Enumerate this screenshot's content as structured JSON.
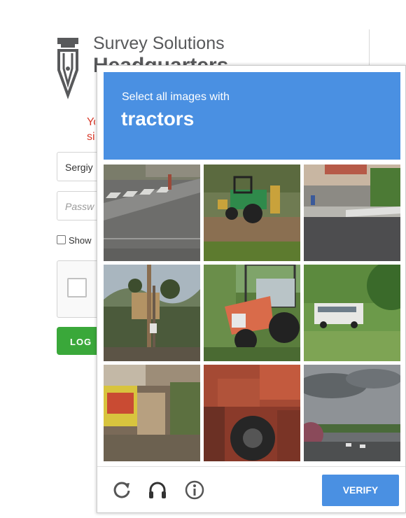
{
  "login_page": {
    "brand_line1": "Survey Solutions",
    "brand_line2": "Headquarters",
    "error_text": "Yo\nsi",
    "username_value": "Sergiy",
    "password_placeholder": "Passw",
    "show_label": "Show",
    "login_label": "LOG"
  },
  "challenge": {
    "instruction": "Select all images with",
    "target": "tractors",
    "tiles": [
      {
        "id": 1,
        "description": "street-crosswalk"
      },
      {
        "id": 2,
        "description": "green-tractor"
      },
      {
        "id": 3,
        "description": "street-storefronts"
      },
      {
        "id": 4,
        "description": "sign-palm-trees"
      },
      {
        "id": 5,
        "description": "orange-tractor"
      },
      {
        "id": 6,
        "description": "white-bus"
      },
      {
        "id": 7,
        "description": "food-truck"
      },
      {
        "id": 8,
        "description": "red-tractor-closeup"
      },
      {
        "id": 9,
        "description": "road-cloudy-sky"
      }
    ],
    "footer": {
      "reload_icon": "reload-icon",
      "audio_icon": "headphones-icon",
      "info_icon": "info-icon",
      "verify_label": "VERIFY"
    },
    "colors": {
      "header": "#4a90e2",
      "verify": "#4a90e2",
      "login_button": "#3aa83a",
      "error_text": "#d93b2b"
    }
  }
}
